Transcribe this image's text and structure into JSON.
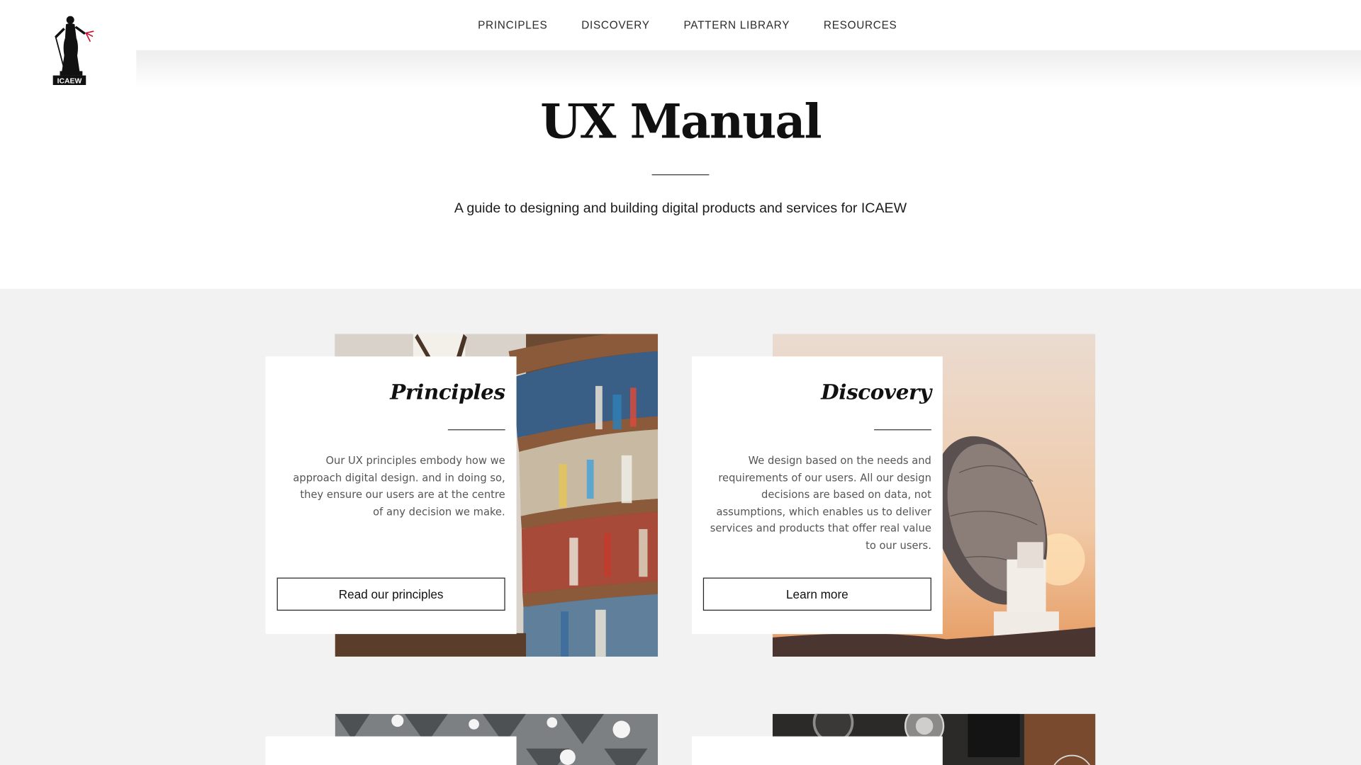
{
  "brand": {
    "logo_text": "ICAEW",
    "accent_color": "#c8102e"
  },
  "nav": {
    "items": [
      {
        "label": "PRINCIPLES"
      },
      {
        "label": "DISCOVERY"
      },
      {
        "label": "PATTERN LIBRARY"
      },
      {
        "label": "RESOURCES"
      }
    ]
  },
  "hero": {
    "title": "UX Manual",
    "subtitle": "A guide to designing and building digital products and services for ICAEW"
  },
  "cards": [
    {
      "title": "Principles",
      "description": "Our UX principles embody how we approach digital design. and in doing so, they ensure our users are at the centre of any decision we make.",
      "button_label": "Read our principles",
      "image": "library-bookshelf-photo"
    },
    {
      "title": "Discovery",
      "description": "We design based on the needs and requirements of our users. All our design decisions are based on data, not assumptions, which enables us to deliver services and products that offer real value to our users.",
      "button_label": "Learn more",
      "image": "satellite-dish-sunset-photo"
    },
    {
      "image": "ceiling-lights-photo"
    },
    {
      "image": "camera-equipment-photo"
    }
  ],
  "colors": {
    "section_background": "#f2f2f2",
    "panel_background": "#ffffff",
    "text_dark": "#111111",
    "text_body": "#555555"
  }
}
